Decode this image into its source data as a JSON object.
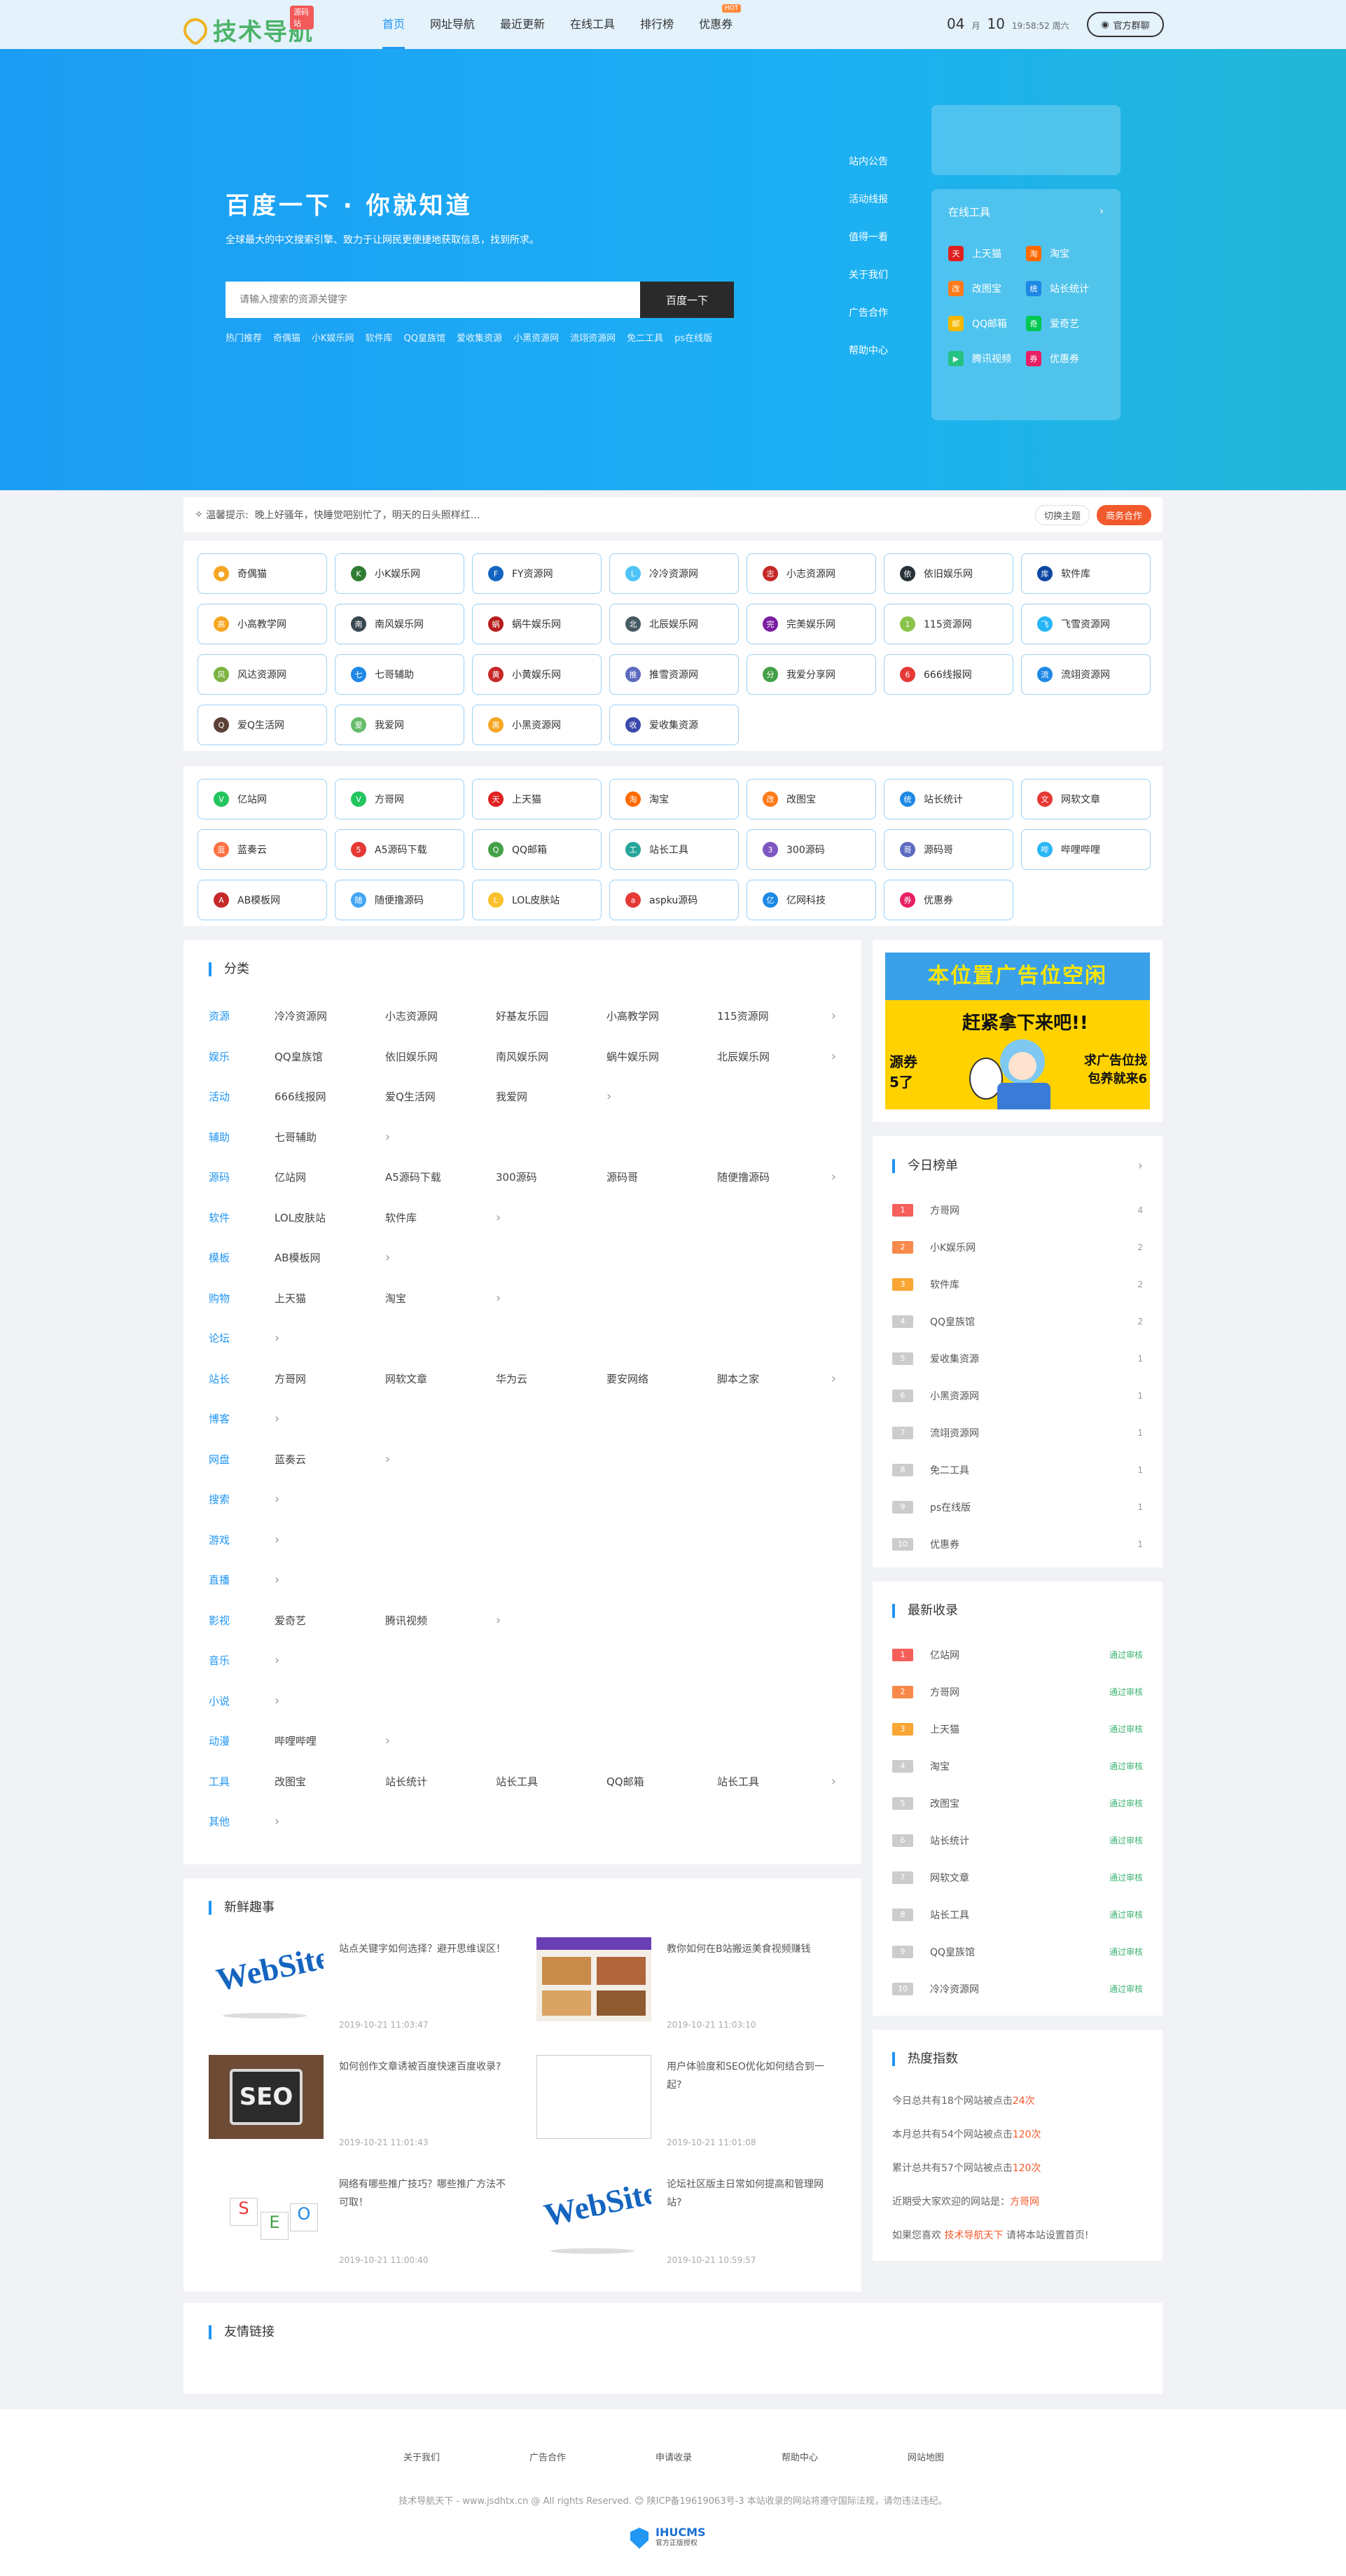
{
  "header": {
    "logo": "技术导航",
    "badge": "源码站",
    "nav": [
      {
        "label": "首页",
        "active": true
      },
      {
        "label": "网址导航"
      },
      {
        "label": "最近更新"
      },
      {
        "label": "在线工具"
      },
      {
        "label": "排行榜"
      },
      {
        "label": "优惠券",
        "hot": "HOT"
      }
    ],
    "date_month": "04",
    "date_month_unit": "月",
    "date_day": "10",
    "date_time": "19:58:52 周六",
    "login": "官方群聊"
  },
  "hero": {
    "title": "百度一下 · 你就知道",
    "subtitle": "全球最大的中文搜索引擎、致力于让网民更便捷地获取信息，找到所求。",
    "placeholder": "请输入搜索的资源关键字",
    "button": "百度一下",
    "hotwords": [
      "热门推荐",
      "奇偶猫",
      "小K娱乐网",
      "软件库",
      "QQ皇族馆",
      "爱收集资源",
      "小黑资源网",
      "流翊资源网",
      "免二工具",
      "ps在线版"
    ],
    "side_links": [
      "站内公告",
      "活动线报",
      "值得一看",
      "关于我们",
      "广告合作",
      "帮助中心"
    ],
    "tools_title": "在线工具",
    "tools": [
      {
        "label": "上天猫",
        "color": "#e02020",
        "icon": "天"
      },
      {
        "label": "淘宝",
        "color": "#ff6a00",
        "icon": "淘"
      },
      {
        "label": "改图宝",
        "color": "#ff7a1a",
        "icon": "改"
      },
      {
        "label": "站长统计",
        "color": "#1e88e5",
        "icon": "统"
      },
      {
        "label": "QQ邮箱",
        "color": "#f5b800",
        "icon": "邮"
      },
      {
        "label": "爱奇艺",
        "color": "#00c853",
        "icon": "奇"
      },
      {
        "label": "腾讯视频",
        "color": "#26c281",
        "icon": "▶"
      },
      {
        "label": "优惠券",
        "color": "#e91e63",
        "icon": "券"
      }
    ]
  },
  "notice": {
    "label": "温馨提示:",
    "text": "晚上好骚年，快睡觉吧别忙了，明天的日头照样红...",
    "theme": "切换主题",
    "coop": "商务合作"
  },
  "grid1": [
    {
      "label": "奇偶猫",
      "color": "#f5a623",
      "icon": "●"
    },
    {
      "label": "小K娱乐网",
      "color": "#2e7d32",
      "icon": "K"
    },
    {
      "label": "FY资源网",
      "color": "#1565c0",
      "icon": "F"
    },
    {
      "label": "冷冷资源网",
      "color": "#4fc3f7",
      "icon": "L"
    },
    {
      "label": "小志资源网",
      "color": "#c62828",
      "icon": "志"
    },
    {
      "label": "依旧娱乐网",
      "color": "#263238",
      "icon": "依"
    },
    {
      "label": "软件库",
      "color": "#0d47a1",
      "icon": "库"
    },
    {
      "label": "小高教学网",
      "color": "#f5a623",
      "icon": "高"
    },
    {
      "label": "南风娱乐网",
      "color": "#37474f",
      "icon": "南"
    },
    {
      "label": "蜗牛娱乐网",
      "color": "#b71c1c",
      "icon": "蜗"
    },
    {
      "label": "北辰娱乐网",
      "color": "#455a64",
      "icon": "北"
    },
    {
      "label": "完美娱乐网",
      "color": "#7b1fa2",
      "icon": "完"
    },
    {
      "label": "115资源网",
      "color": "#8bc34a",
      "icon": "1"
    },
    {
      "label": "飞雪资源网",
      "color": "#29b6f6",
      "icon": "飞"
    },
    {
      "label": "风达资源网",
      "color": "#7cb342",
      "icon": "风"
    },
    {
      "label": "七哥辅助",
      "color": "#1e88e5",
      "icon": "七"
    },
    {
      "label": "小黄娱乐网",
      "color": "#c62828",
      "icon": "黄"
    },
    {
      "label": "推雪资源网",
      "color": "#5c6bc0",
      "icon": "推"
    },
    {
      "label": "我爱分享网",
      "color": "#43a047",
      "icon": "分"
    },
    {
      "label": "666线报网",
      "color": "#e53935",
      "icon": "6"
    },
    {
      "label": "流翊资源网",
      "color": "#1e88e5",
      "icon": "流"
    },
    {
      "label": "爱Q生活网",
      "color": "#5d4037",
      "icon": "Q"
    },
    {
      "label": "我爱网",
      "color": "#66bb6a",
      "icon": "爱"
    },
    {
      "label": "小黑资源网",
      "color": "#f5a623",
      "icon": "黑"
    },
    {
      "label": "爱收集资源",
      "color": "#3949ab",
      "icon": "收"
    }
  ],
  "grid2": [
    {
      "label": "亿站网",
      "color": "#22c55e",
      "icon": "V"
    },
    {
      "label": "方哥网",
      "color": "#22c55e",
      "icon": "V"
    },
    {
      "label": "上天猫",
      "color": "#e02020",
      "icon": "天"
    },
    {
      "label": "淘宝",
      "color": "#ff6a00",
      "icon": "淘"
    },
    {
      "label": "改图宝",
      "color": "#ff7a1a",
      "icon": "改"
    },
    {
      "label": "站长统计",
      "color": "#1e88e5",
      "icon": "统"
    },
    {
      "label": "网软文章",
      "color": "#e53935",
      "icon": "文"
    },
    {
      "label": "蓝奏云",
      "color": "#ff7043",
      "icon": "蓝"
    },
    {
      "label": "A5源码下载",
      "color": "#e53935",
      "icon": "5"
    },
    {
      "label": "QQ邮箱",
      "color": "#43a047",
      "icon": "Q"
    },
    {
      "label": "站长工具",
      "color": "#26a69a",
      "icon": "工"
    },
    {
      "label": "300源码",
      "color": "#7e57c2",
      "icon": "3"
    },
    {
      "label": "源码哥",
      "color": "#5c6bc0",
      "icon": "哥"
    },
    {
      "label": "哔哩哔哩",
      "color": "#29b6f6",
      "icon": "哔"
    },
    {
      "label": "AB模板网",
      "color": "#c62828",
      "icon": "A"
    },
    {
      "label": "随便撸源码",
      "color": "#42a5f5",
      "icon": "随"
    },
    {
      "label": "LOL皮肤站",
      "color": "#fbc02d",
      "icon": "L"
    },
    {
      "label": "aspku源码",
      "color": "#e53935",
      "icon": "a"
    },
    {
      "label": "亿网科技",
      "color": "#1e88e5",
      "icon": "亿"
    },
    {
      "label": "优惠券",
      "color": "#e91e63",
      "icon": "券"
    }
  ],
  "category": {
    "title": "分类",
    "rows": [
      {
        "name": "资源",
        "links": [
          "冷冷资源网",
          "小志资源网",
          "好基友乐园",
          "小高教学网",
          "115资源网"
        ]
      },
      {
        "name": "娱乐",
        "links": [
          "QQ皇族馆",
          "依旧娱乐网",
          "南风娱乐网",
          "蜗牛娱乐网",
          "北辰娱乐网"
        ]
      },
      {
        "name": "活动",
        "links": [
          "666线报网",
          "爱Q生活网",
          "我爱网"
        ]
      },
      {
        "name": "辅助",
        "links": [
          "七哥辅助"
        ]
      },
      {
        "name": "源码",
        "links": [
          "亿站网",
          "A5源码下载",
          "300源码",
          "源码哥",
          "随便撸源码"
        ]
      },
      {
        "name": "软件",
        "links": [
          "LOL皮肤站",
          "软件库"
        ]
      },
      {
        "name": "模板",
        "links": [
          "AB模板网"
        ]
      },
      {
        "name": "购物",
        "links": [
          "上天猫",
          "淘宝"
        ]
      },
      {
        "name": "论坛",
        "links": []
      },
      {
        "name": "站长",
        "links": [
          "方哥网",
          "网软文章",
          "华为云",
          "要安网络",
          "脚本之家"
        ]
      },
      {
        "name": "博客",
        "links": []
      },
      {
        "name": "网盘",
        "links": [
          "蓝奏云"
        ]
      },
      {
        "name": "搜索",
        "links": []
      },
      {
        "name": "游戏",
        "links": []
      },
      {
        "name": "直播",
        "links": []
      },
      {
        "name": "影视",
        "links": [
          "爱奇艺",
          "腾讯视频"
        ]
      },
      {
        "name": "音乐",
        "links": []
      },
      {
        "name": "小说",
        "links": []
      },
      {
        "name": "动漫",
        "links": [
          "哔哩哔哩"
        ]
      },
      {
        "name": "工具",
        "links": [
          "改图宝",
          "站长统计",
          "站长工具",
          "QQ邮箱",
          "站长工具"
        ]
      },
      {
        "name": "其他",
        "links": []
      }
    ]
  },
  "news": {
    "title": "新鲜趣事",
    "items": [
      {
        "title": "站点关键字如何选择？避开思维误区！",
        "time": "2019-10-21 11:03:47",
        "thumb": "website"
      },
      {
        "title": "教你如何在B站搬运美食视频赚钱",
        "time": "2019-10-21 11:03:10",
        "thumb": "food"
      },
      {
        "title": "如何创作文章诱被百度快速百度收录?",
        "time": "2019-10-21 11:01:43",
        "thumb": "seo"
      },
      {
        "title": "用户体验度和SEO优化如何结合到一起?",
        "time": "2019-10-21 11:01:08",
        "thumb": "blank"
      },
      {
        "title": "网络有哪些推广技巧？哪些推广方法不可取！",
        "time": "2019-10-21 11:00:40",
        "thumb": "cubes"
      },
      {
        "title": "论坛社区版主日常如何提高和管理网站?",
        "time": "2019-10-21 10:59:57",
        "thumb": "website"
      }
    ]
  },
  "banner": {
    "top": "本位置广告位空闲",
    "mid": "赶紧拿下来吧!!",
    "left": "源券\n5了",
    "right": "求广告位找\n包养就来6"
  },
  "today": {
    "title": "今日榜单",
    "items": [
      {
        "name": "方哥网",
        "v": "4"
      },
      {
        "name": "小K娱乐网",
        "v": "2"
      },
      {
        "name": "软件库",
        "v": "2"
      },
      {
        "name": "QQ皇族馆",
        "v": "2"
      },
      {
        "name": "爱收集资源",
        "v": "1"
      },
      {
        "name": "小黑资源网",
        "v": "1"
      },
      {
        "name": "流翊资源网",
        "v": "1"
      },
      {
        "name": "免二工具",
        "v": "1"
      },
      {
        "name": "ps在线版",
        "v": "1"
      },
      {
        "name": "优惠券",
        "v": "1"
      }
    ]
  },
  "latest": {
    "title": "最新收录",
    "status": "通过审核",
    "items": [
      "亿站网",
      "方哥网",
      "上天猫",
      "淘宝",
      "改图宝",
      "站长统计",
      "网软文章",
      "站长工具",
      "QQ皇族馆",
      "冷冷资源网"
    ]
  },
  "hot": {
    "title": "热度指数",
    "l1a": "今日总共有18个网站被点击",
    "l1b": "24次",
    "l2a": "本月总共有54个网站被点击",
    "l2b": "120次",
    "l3a": "累计总共有57个网站被点击",
    "l3b": "120次",
    "l4a": "近期受大家欢迎的网站是：",
    "l4b": "方哥网",
    "l5a": "如果您喜欢",
    "l5b": "技术导航天下",
    "l5c": "请将本站设置首页!"
  },
  "friend": {
    "title": "友情链接"
  },
  "footer": {
    "links": [
      "关于我们",
      "广告合作",
      "申请收录",
      "帮助中心",
      "网站地图"
    ],
    "copy": "技术导航天下 - www.jsdhtx.cn @ All rights Reserved. 😊 陕ICP备19619063号-3 本站收录的网站将遵守国际法规，请勿违法违纪。",
    "badge": "IHUCMS",
    "badge_sub": "官方正版授权"
  }
}
